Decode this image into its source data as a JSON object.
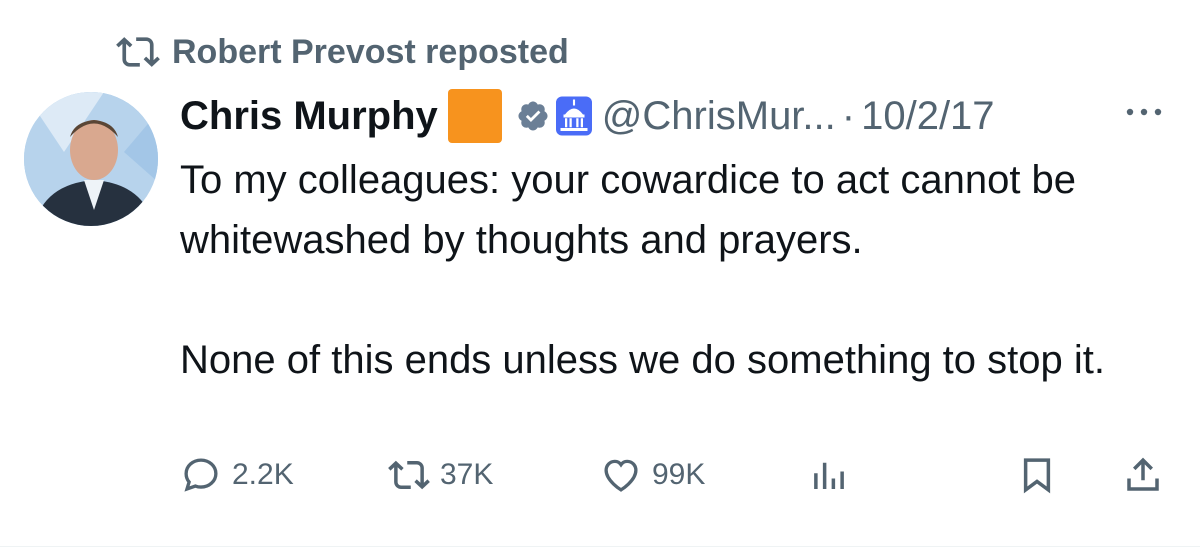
{
  "repost": {
    "text": "Robert Prevost reposted",
    "icon": "repost-icon"
  },
  "author": {
    "name": "Chris Murphy",
    "handle": "@ChrisMur...",
    "separator": "·",
    "date": "10/2/17",
    "badges": [
      "orange-square-emoji",
      "verified-icon",
      "capitol-badge-icon"
    ]
  },
  "tweet": {
    "paragraphs": [
      "To my colleagues: your cowardice to act cannot be whitewashed by thoughts and prayers.",
      "None of this ends unless we do something to stop it."
    ]
  },
  "actions": {
    "reply": {
      "icon": "reply-icon",
      "count": "2.2K"
    },
    "repost": {
      "icon": "repost-icon",
      "count": "37K"
    },
    "like": {
      "icon": "heart-icon",
      "count": "99K"
    },
    "views": {
      "icon": "views-icon"
    },
    "bookmark": {
      "icon": "bookmark-icon"
    },
    "share": {
      "icon": "share-icon"
    }
  },
  "colors": {
    "text": "#0f1419",
    "secondary": "#536471",
    "orange": "#f7931e",
    "verified_blue": "#6b7f96",
    "capitol_bg": "#4a6cf7"
  }
}
